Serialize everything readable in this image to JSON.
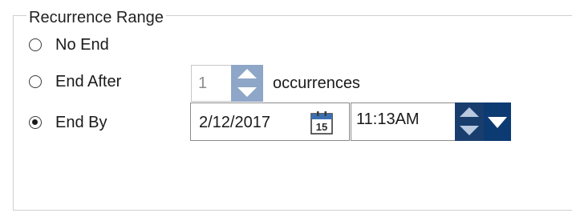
{
  "group": {
    "title": "Recurrence Range"
  },
  "options": {
    "no_end": {
      "label": "No End",
      "selected": false
    },
    "end_after": {
      "label": "End After",
      "selected": false,
      "value": "1",
      "suffix": "occurrences"
    },
    "end_by": {
      "label": "End By",
      "selected": true,
      "date": "2/12/2017",
      "time": "11:13AM",
      "calendar_day": "15"
    }
  },
  "icons": {
    "calendar": "calendar-icon",
    "spin_up": "chevron-up-icon",
    "spin_down": "chevron-down-icon",
    "dropdown": "dropdown-arrow-icon"
  },
  "colors": {
    "accent_dark": "#0c3a73",
    "spinner_light": "#8ea6c7"
  }
}
